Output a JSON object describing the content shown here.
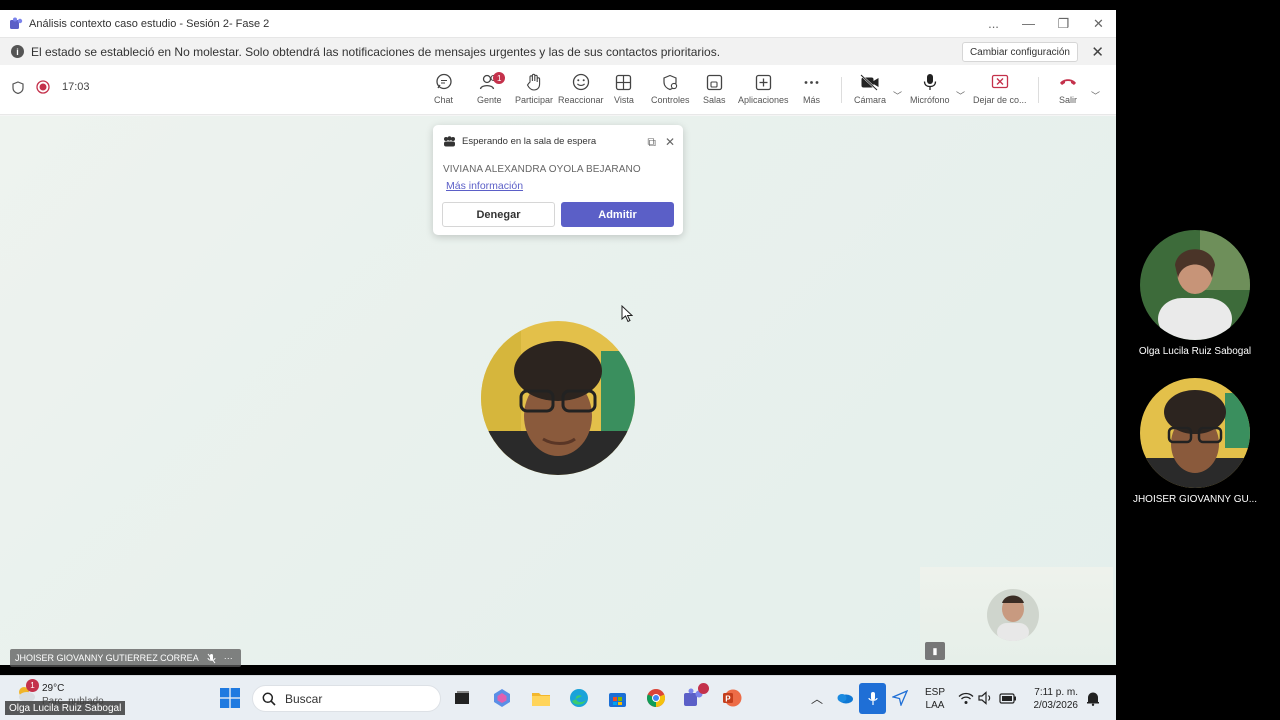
{
  "window": {
    "title": "Análisis contexto caso estudio - Sesión 2- Fase 2",
    "controls": [
      "...",
      "—",
      "❐",
      "✕"
    ]
  },
  "banner": {
    "message": "El estado se estableció en No molestar. Solo obtendrá las notificaciones de mensajes urgentes y las de sus contactos prioritarios.",
    "button": "Cambiar configuración"
  },
  "meeting": {
    "timer": "17:03",
    "toolbar": {
      "chat": "Chat",
      "people": "Gente",
      "people_badge": "1",
      "raise": "Participar",
      "react": "Reaccionar",
      "view": "Vista",
      "controls": "Controles",
      "rooms": "Salas",
      "apps": "Aplicaciones",
      "more": "Más",
      "camera": "Cámara",
      "mic": "Micrófono",
      "share": "Dejar de co...",
      "leave": "Salir"
    }
  },
  "lobby": {
    "title": "Esperando en la sala de espera",
    "person": "VIVIANA ALEXANDRA OYOLA BEJARANO",
    "more_info": "Más información",
    "deny": "Denegar",
    "admit": "Admitir"
  },
  "stage": {
    "name_tag": "JHOISER GIOVANNY GUTIERREZ CORREA",
    "name_tag_more": "···"
  },
  "sidebar": {
    "participants": [
      {
        "name": "Olga Lucila Ruiz Sabogal"
      },
      {
        "name": "JHOISER GIOVANNY GU..."
      }
    ]
  },
  "taskbar": {
    "weather_badge": "1",
    "temperature": "29°C",
    "weather": "Parc. nublado",
    "search_placeholder": "Buscar",
    "lang_top": "ESP",
    "lang_bottom": "LAA",
    "time": "7:11 p. m.",
    "date": "2/03/2026"
  },
  "caption": "Olga Lucila Ruiz Sabogal",
  "colors": {
    "accent": "#5b5fc7",
    "leave": "#c4314b",
    "badge": "#c4314b"
  }
}
